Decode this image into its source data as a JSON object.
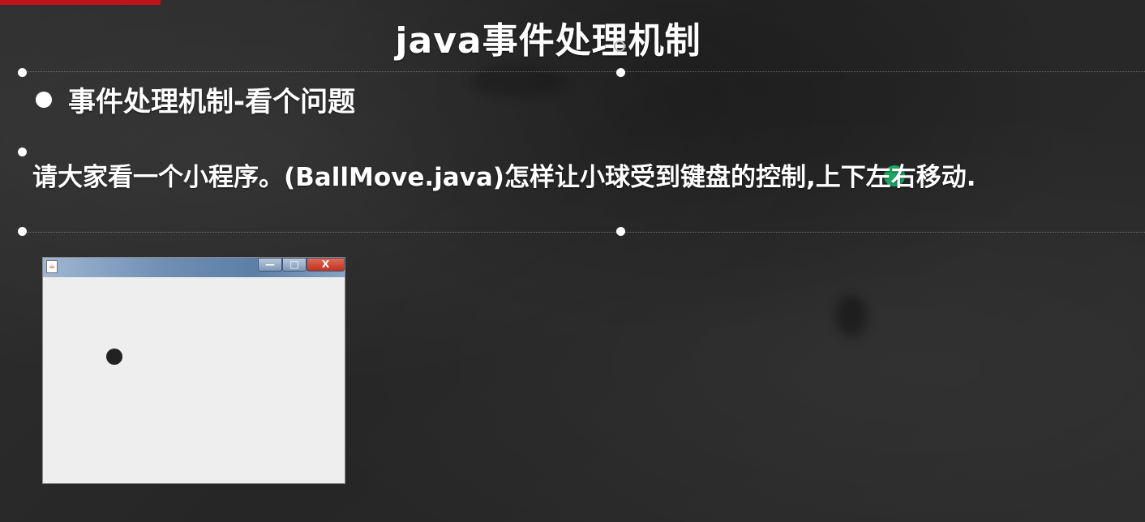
{
  "slide": {
    "title": "java事件处理机制",
    "heading": "事件处理机制-看个问题",
    "body": "请大家看一个小程序。(BallMove.java)怎样让小球受到键盘的控制,上下左右移动.",
    "accent_color": "#c0141a"
  },
  "java_window": {
    "icon": "java-cup-icon",
    "icon_glyph": "☕",
    "min_glyph": "—",
    "max_glyph": "□",
    "close_glyph": "X"
  }
}
